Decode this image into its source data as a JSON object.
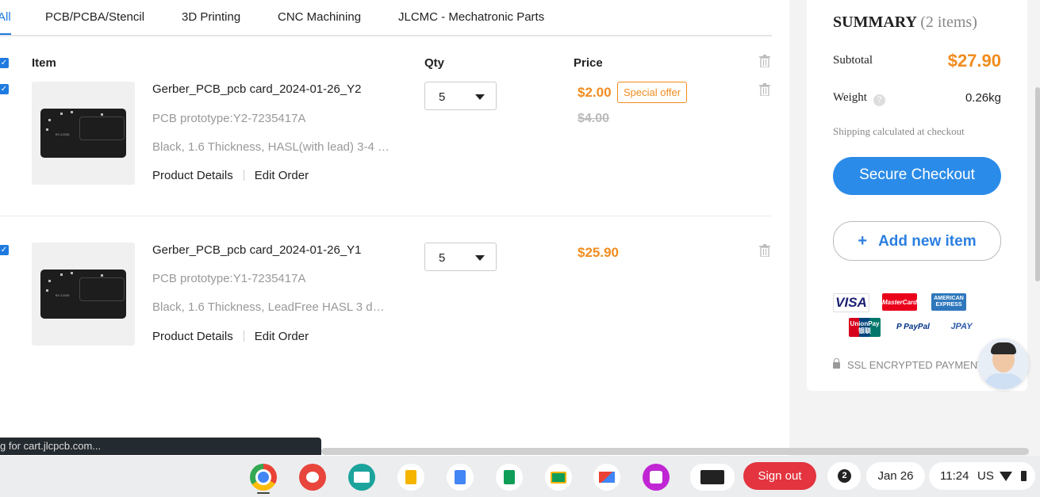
{
  "tabs": [
    {
      "label": "All"
    },
    {
      "label": "PCB/PCBA/Stencil"
    },
    {
      "label": "3D Printing"
    },
    {
      "label": "CNC Machining"
    },
    {
      "label": "JLCMC - Mechatronic Parts"
    }
  ],
  "table": {
    "headers": {
      "item": "Item",
      "qty": "Qty",
      "price": "Price"
    },
    "rows": [
      {
        "name": "Gerber_PCB_pcb card_2024-01-26_Y2",
        "prototype": "PCB prototype:Y2-7235417A",
        "specs": "Black, 1.6 Thickness, HASL(with lead) 3-4 …",
        "details_link": "Product Details",
        "edit_link": "Edit Order",
        "qty": "5",
        "price": "$2.00",
        "offer": "Special offer",
        "old_price": "$4.00",
        "checked": true
      },
      {
        "name": "Gerber_PCB_pcb card_2024-01-26_Y1",
        "prototype": "PCB prototype:Y1-7235417A",
        "specs": "Black, 1.6 Thickness, LeadFree HASL 3 d…",
        "details_link": "Product Details",
        "edit_link": "Edit Order",
        "qty": "5",
        "price": "$25.90",
        "checked": true
      }
    ]
  },
  "status_bar": {
    "text": "g for cart.jlcpcb.com..."
  },
  "summary": {
    "title": "SUMMARY",
    "count": "(2 items)",
    "subtotal_label": "Subtotal",
    "subtotal_value": "$27.90",
    "weight_label": "Weight",
    "weight_value": "0.26kg",
    "help_glyph": "?",
    "shipping_note": "Shipping calculated at checkout",
    "checkout_label": "Secure Checkout",
    "add_plus": "+",
    "add_label": "Add new item",
    "payments": [
      "VISA",
      "MasterCard",
      "AMERICAN EXPRESS",
      "UnionPay 银联",
      "P PayPal",
      "JPAY"
    ],
    "ssl_text": "SSL ENCRYPTED PAYMENT"
  },
  "shelf": {
    "apps": [
      {
        "name": "Chrome",
        "icon": "chrome-icon",
        "color": "#4285f4"
      },
      {
        "name": "Canvas",
        "icon": "palette-icon",
        "color": "#e8453c"
      },
      {
        "name": "Classroom",
        "icon": "card-icon",
        "color": "#1ba39c"
      },
      {
        "name": "Slides",
        "icon": "slides-icon",
        "color": "#f4b400"
      },
      {
        "name": "Docs",
        "icon": "docs-icon",
        "color": "#4285f4"
      },
      {
        "name": "Sheets",
        "icon": "sheets-icon",
        "color": "#0f9d58"
      },
      {
        "name": "Classroom",
        "icon": "classroom-icon",
        "color": "#0f9d58"
      },
      {
        "name": "Gmail",
        "icon": "gmail-icon",
        "color": "#ea4335"
      },
      {
        "name": "Photo",
        "icon": "photo-icon",
        "color": "#c026d3"
      },
      {
        "name": "Screen",
        "icon": "screen-icon",
        "color": "#222222"
      }
    ],
    "sign_out": "Sign out",
    "notifications": "2",
    "date": "Jan 26",
    "time": "11:24",
    "locale": "US"
  },
  "colors": {
    "accent": "#1f7ae0",
    "price": "#f08c1e",
    "signout": "#e3343f"
  }
}
